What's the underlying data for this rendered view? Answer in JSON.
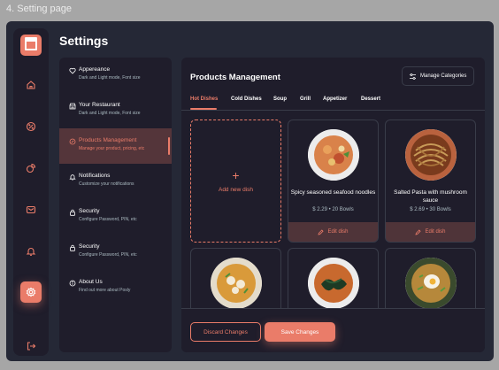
{
  "caption": "4. Setting page",
  "colors": {
    "accent": "#ea7c69",
    "background": "#252836",
    "panel": "#1f1d2b",
    "border": "#393c49",
    "muted": "#abbbc2"
  },
  "sidebar": {
    "logo_icon": "store-icon",
    "items": [
      {
        "icon": "home-icon"
      },
      {
        "icon": "discount-icon"
      },
      {
        "icon": "dashboard-icon"
      },
      {
        "icon": "message-icon"
      },
      {
        "icon": "notification-icon"
      },
      {
        "icon": "settings-icon",
        "active": true
      },
      {
        "icon": "logout-icon"
      }
    ]
  },
  "page_title": "Settings",
  "menu": [
    {
      "icon": "heart-icon",
      "label": "Appereance",
      "desc": "Dark and Light mode, Font size"
    },
    {
      "icon": "store-icon",
      "label": "Your Restaurant",
      "desc": "Dark and Light mode, Font size"
    },
    {
      "icon": "discount-icon",
      "label": "Products Management",
      "desc": "Manage your product, pricing, etc",
      "active": true
    },
    {
      "icon": "notification-icon",
      "label": "Notifications",
      "desc": "Customize your notifications"
    },
    {
      "icon": "lock-icon",
      "label": "Security",
      "desc": "Configure Password, PIN, etc"
    },
    {
      "icon": "lock-icon",
      "label": "Security",
      "desc": "Configure Password, PIN, etc"
    },
    {
      "icon": "info-icon",
      "label": "About Us",
      "desc": "Find out more about Posly"
    }
  ],
  "products": {
    "title": "Products Management",
    "manage_label": "Manage Categories",
    "tabs": [
      "Hot Dishes",
      "Cold Dishes",
      "Soup",
      "Grill",
      "Appetizer",
      "Dessert"
    ],
    "active_tab": "Hot Dishes",
    "add_label": "Add new dish",
    "add_symbol": "+",
    "edit_label": "Edit dish",
    "dishes": [
      {
        "name": "Spicy seasoned seafood noodles",
        "price": "$ 2.29",
        "stock": "20 Bowls"
      },
      {
        "name": "Salted Pasta with mushroom sauce",
        "price": "$ 2.69",
        "stock": "30 Bowls"
      },
      {
        "name": "",
        "price": "",
        "stock": ""
      },
      {
        "name": "",
        "price": "",
        "stock": ""
      },
      {
        "name": "",
        "price": "",
        "stock": ""
      }
    ]
  },
  "footer": {
    "discard_label": "Discard Changes",
    "save_label": "Save Changes"
  }
}
